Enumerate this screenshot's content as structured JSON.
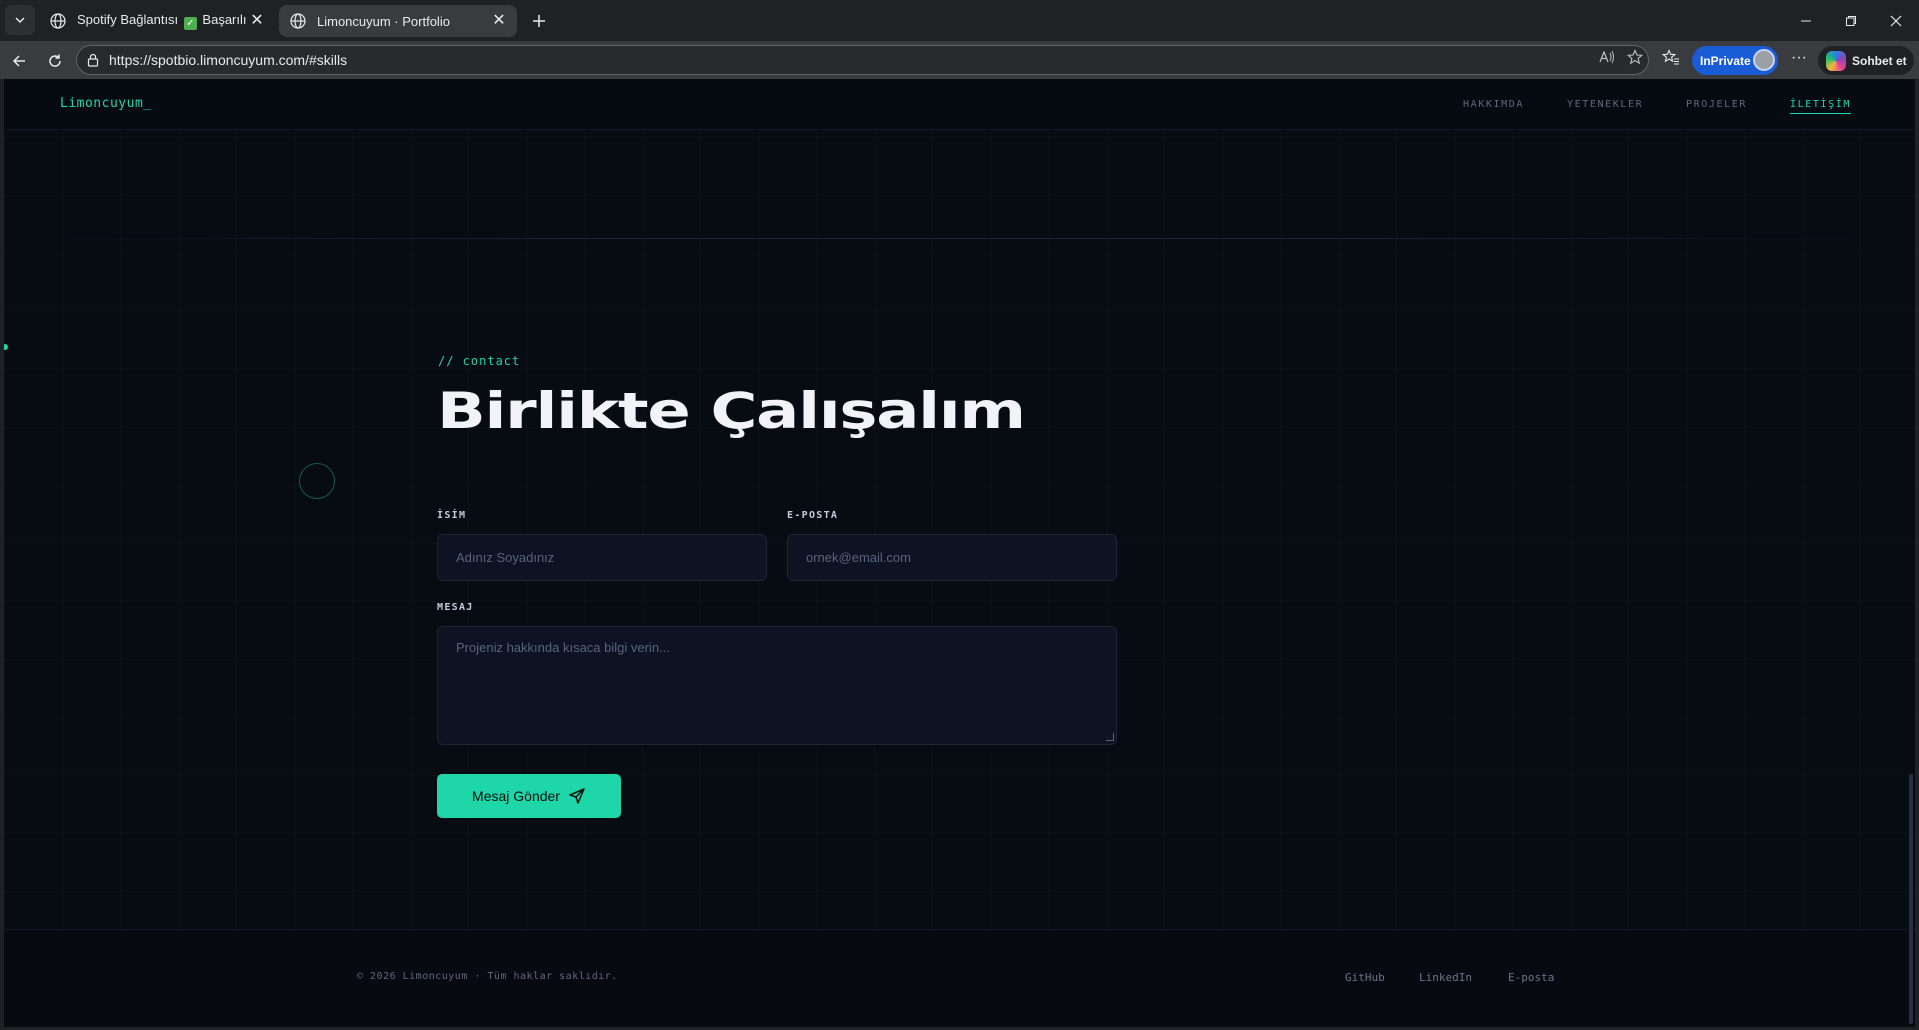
{
  "browser": {
    "tabs": [
      {
        "title_prefix": "Spotify Bağlantısı",
        "check": "✓",
        "title_suffix": "Başarılı"
      },
      {
        "title": "Limoncuyum · Portfolio"
      }
    ],
    "url": "https://spotbio.limoncuyum.com/#skills",
    "inprivate_label": "InPrivate",
    "copilot_label": "Sohbet et"
  },
  "site": {
    "logo": "Limoncuyum_",
    "nav": [
      "HAKKIMDA",
      "YETENEKLER",
      "PROJELER",
      "İLETİŞİM"
    ],
    "active_nav": "İLETİŞİM",
    "accent_color": "#1fd6a8"
  },
  "contact": {
    "kicker": "// contact",
    "heading": "Birlikte Çalışalım",
    "name_label": "İSİM",
    "name_placeholder": "Adınız Soyadınız",
    "email_label": "E-POSTA",
    "email_placeholder": "ornek@email.com",
    "message_label": "MESAJ",
    "message_placeholder": "Projeniz hakkında kısaca bilgi verin...",
    "submit_label": "Mesaj Gönder"
  },
  "footer": {
    "copyright": "© 2026 Limoncuyum · Tüm haklar saklıdır.",
    "links": [
      "GitHub",
      "LinkedIn",
      "E-posta"
    ]
  }
}
